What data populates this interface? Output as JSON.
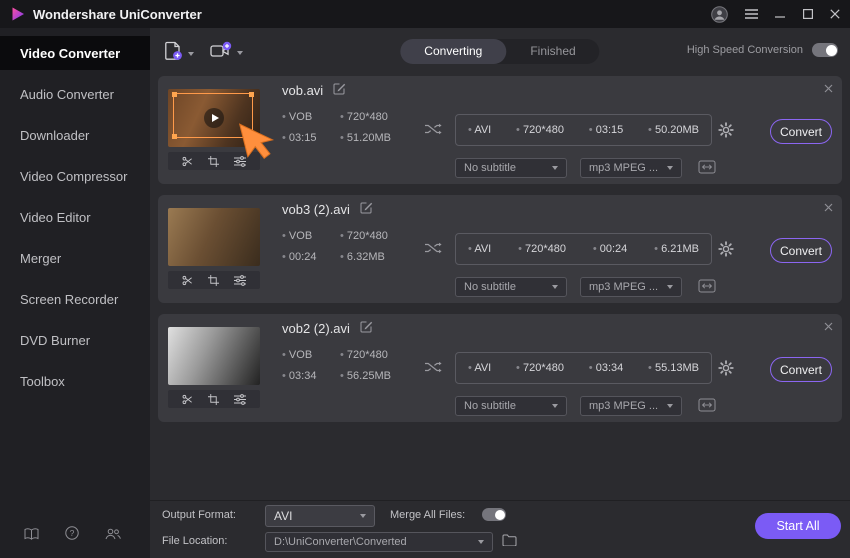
{
  "colors": {
    "accent": "#7b5bf5",
    "highlight_orange": "#ff8f3d",
    "card_bg": "#3a3a3f"
  },
  "window": {
    "title": "Wondershare UniConverter"
  },
  "sidebar": {
    "items": [
      {
        "label": "Video Converter",
        "active": true
      },
      {
        "label": "Audio Converter",
        "active": false
      },
      {
        "label": "Downloader",
        "active": false
      },
      {
        "label": "Video Compressor",
        "active": false
      },
      {
        "label": "Video Editor",
        "active": false
      },
      {
        "label": "Merger",
        "active": false
      },
      {
        "label": "Screen Recorder",
        "active": false
      },
      {
        "label": "DVD Burner",
        "active": false
      },
      {
        "label": "Toolbox",
        "active": false
      }
    ]
  },
  "toolbar": {
    "tabs": [
      {
        "label": "Converting",
        "active": true
      },
      {
        "label": "Finished",
        "active": false
      }
    ],
    "high_speed_label": "High Speed Conversion",
    "high_speed_on": true
  },
  "files": [
    {
      "name": "vob.avi",
      "source": {
        "format": "VOB",
        "resolution": "720*480",
        "duration": "03:15",
        "size": "51.20MB"
      },
      "target": {
        "format": "AVI",
        "resolution": "720*480",
        "duration": "03:15",
        "size": "50.20MB"
      },
      "subtitle": "No subtitle",
      "audio": "mp3 MPEG ...",
      "convert_label": "Convert"
    },
    {
      "name": "vob3 (2).avi",
      "source": {
        "format": "VOB",
        "resolution": "720*480",
        "duration": "00:24",
        "size": "6.32MB"
      },
      "target": {
        "format": "AVI",
        "resolution": "720*480",
        "duration": "00:24",
        "size": "6.21MB"
      },
      "subtitle": "No subtitle",
      "audio": "mp3 MPEG ...",
      "convert_label": "Convert"
    },
    {
      "name": "vob2 (2).avi",
      "source": {
        "format": "VOB",
        "resolution": "720*480",
        "duration": "03:34",
        "size": "56.25MB"
      },
      "target": {
        "format": "AVI",
        "resolution": "720*480",
        "duration": "03:34",
        "size": "55.13MB"
      },
      "subtitle": "No subtitle",
      "audio": "mp3 MPEG ...",
      "convert_label": "Convert"
    }
  ],
  "footer": {
    "output_format_label": "Output Format:",
    "output_format_value": "AVI",
    "merge_label": "Merge All Files:",
    "merge_on": true,
    "file_location_label": "File Location:",
    "file_location_value": "D:\\UniConverter\\Converted",
    "start_all_label": "Start All"
  },
  "icons": {
    "logo": "play-triangle-gradient",
    "avatar": "user-circle",
    "menu": "hamburger",
    "minimize": "minus-line",
    "maximize": "square-outline",
    "close": "x-cross",
    "add_file": "document-plus",
    "add_device": "camera-plus",
    "shuffle": "crossed-arrows",
    "settings": "gear",
    "edit": "pencil",
    "trim": "scissors",
    "crop": "crop-frame",
    "effects": "sliders",
    "resolution": "screen-arrows",
    "dropdown": "chevron-down",
    "folder": "folder",
    "library": "book",
    "help": "question-circle",
    "community": "users",
    "pointer": "orange-cursor-arrow"
  }
}
